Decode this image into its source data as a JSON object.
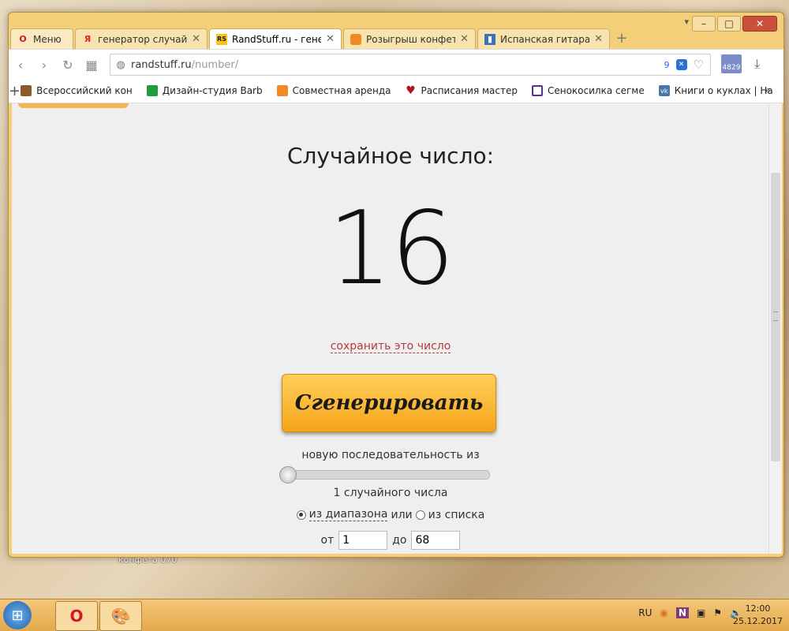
{
  "desktop": {
    "label": "конфета 070"
  },
  "browser": {
    "tab_menu_icon": "▾",
    "tabs": [
      {
        "label": "Меню",
        "icon": "opera-icon"
      },
      {
        "label": "генератор случайных",
        "icon": "yandex-icon"
      },
      {
        "label": "RandStuff.ru - генерато",
        "icon": "randstuff-icon"
      },
      {
        "label": "Розыгрыш конфетки",
        "icon": "orange-icon"
      },
      {
        "label": "Испанская гитара - Gi",
        "icon": "chart-icon"
      }
    ],
    "address": {
      "host": "randstuff.ru",
      "path": "/number/",
      "badge_count": "9"
    },
    "mail_count": "4829",
    "bookmarks": [
      {
        "label": "Всероссийский кон",
        "color": "#8b5a2b"
      },
      {
        "label": "Дизайн-студия Barb",
        "color": "#1e9e3e"
      },
      {
        "label": "Совместная аренда",
        "color": "#f08a24"
      },
      {
        "label": "Расписания мастер",
        "color": "#b3141f"
      },
      {
        "label": "Сенокосилка сегме",
        "color": "#5b2d8e"
      },
      {
        "label": "Книги о куклах | На",
        "color": "#4a76a8"
      }
    ]
  },
  "page": {
    "title": "Случайное число:",
    "number": "16",
    "save_link": "сохранить это число",
    "generate_button": "Сгенерировать",
    "sequence_label": "новую последовательность из",
    "slider_fraction": 0.0,
    "count_label": "1 случайного числа",
    "mode_range": "из диапазона",
    "mode_or": "или",
    "mode_list": "из списка",
    "from_label": "от",
    "from_value": "1",
    "to_label": "до",
    "to_value": "68"
  },
  "taskbar": {
    "lang": "RU",
    "time": "12:00",
    "date": "25.12.2017"
  }
}
